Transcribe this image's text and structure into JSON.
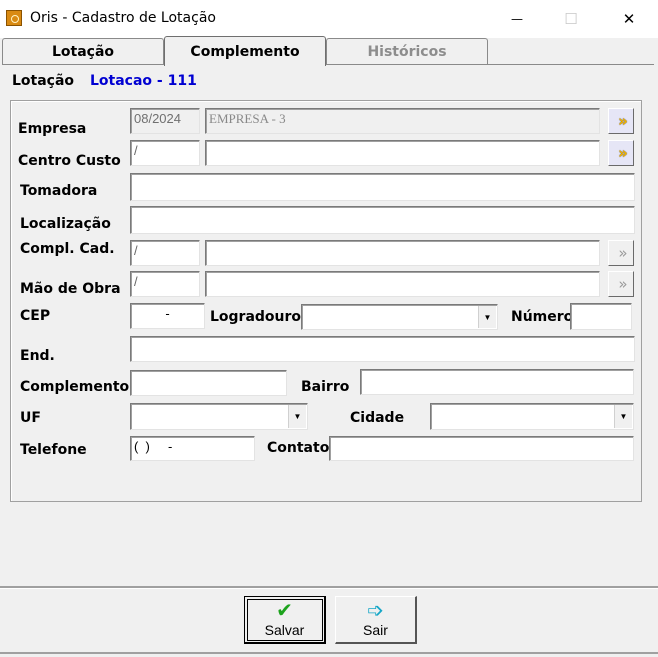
{
  "window": {
    "title": "Oris - Cadastro de Lotação",
    "minimize": "—",
    "maximize": "☐",
    "close": "✕"
  },
  "tabs": [
    {
      "label": "Lotação"
    },
    {
      "label": "Complemento"
    },
    {
      "label": "Históricos"
    }
  ],
  "header": {
    "lotacao_label": "Lotação",
    "lotacao_value": "Lotacao - 111"
  },
  "form": {
    "empresa": {
      "label": "Empresa",
      "period": "08/2024",
      "name": "EMPRESA - 3"
    },
    "centro_custo": {
      "label": "Centro Custo",
      "code": "/",
      "name": ""
    },
    "tomadora": {
      "label": "Tomadora",
      "value": ""
    },
    "localizacao": {
      "label": "Localização",
      "value": ""
    },
    "compl_cad": {
      "label": "Compl. Cad.",
      "code": "/",
      "name": ""
    },
    "mao_de_obra": {
      "label": "Mão de Obra",
      "code": "/",
      "name": ""
    },
    "cep": {
      "label": "CEP",
      "value": "-"
    },
    "logradouro": {
      "label": "Logradouro",
      "value": ""
    },
    "numero": {
      "label": "Número",
      "value": ""
    },
    "end": {
      "label": "End.",
      "value": ""
    },
    "complemento": {
      "label": "Complemento",
      "value": ""
    },
    "bairro": {
      "label": "Bairro",
      "value": ""
    },
    "uf": {
      "label": "UF",
      "value": ""
    },
    "cidade": {
      "label": "Cidade",
      "value": ""
    },
    "telefone": {
      "label": "Telefone",
      "value": "(  )     -"
    },
    "contato": {
      "label": "Contato",
      "value": ""
    }
  },
  "buttons": {
    "salvar": "Salvar",
    "sair": "Sair"
  },
  "icons": {
    "lookup_active": "double-chevron-right-icon",
    "lookup_disabled": "double-chevron-right-icon",
    "dropdown": "triangle-down-icon",
    "salvar": "checkmark-icon",
    "sair": "arrow-right-icon"
  }
}
